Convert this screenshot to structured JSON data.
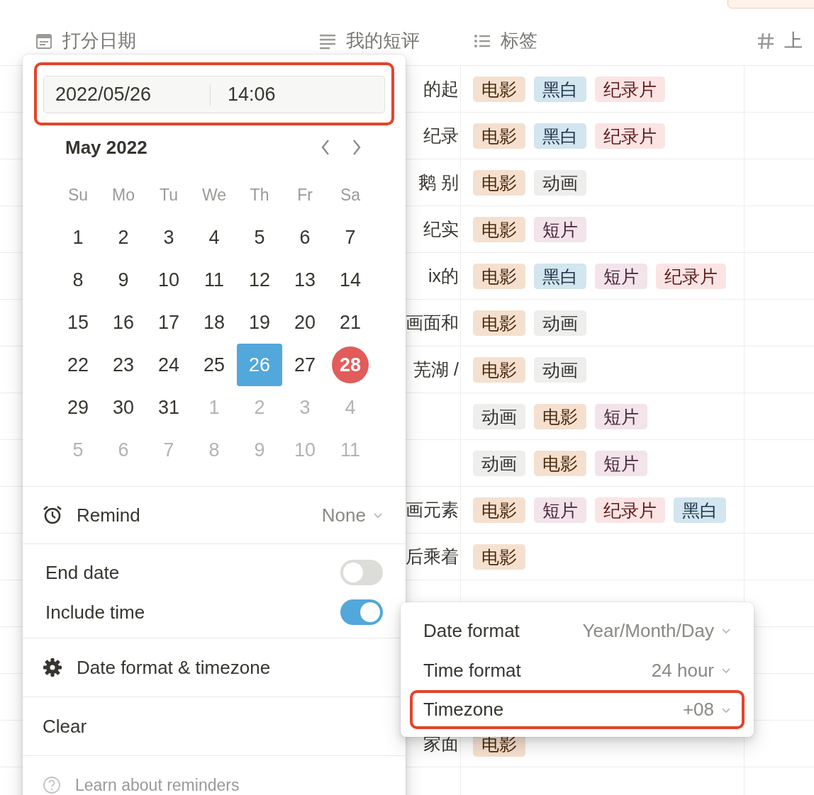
{
  "table": {
    "columns": [
      {
        "kind": "date",
        "label": "打分日期"
      },
      {
        "kind": "text",
        "label": "我的短评"
      },
      {
        "kind": "multi",
        "label": "标签"
      },
      {
        "kind": "number",
        "label": "上"
      }
    ],
    "rows": [
      {
        "review": "的起",
        "tags": [
          {
            "label": "电影",
            "color": "#f5e0cf"
          },
          {
            "label": "黑白",
            "color": "#d3e5ef"
          },
          {
            "label": "纪录片",
            "color": "#fbe4e4"
          }
        ]
      },
      {
        "review": "纪录",
        "tags": [
          {
            "label": "电影",
            "color": "#f5e0cf"
          },
          {
            "label": "黑白",
            "color": "#d3e5ef"
          },
          {
            "label": "纪录片",
            "color": "#fbe4e4"
          }
        ]
      },
      {
        "review": "鹅 别",
        "tags": [
          {
            "label": "电影",
            "color": "#f5e0cf"
          },
          {
            "label": "动画",
            "color": "#eeeeed"
          }
        ]
      },
      {
        "review": "纪实",
        "tags": [
          {
            "label": "电影",
            "color": "#f5e0cf"
          },
          {
            "label": "短片",
            "color": "#f2e4ea"
          }
        ]
      },
      {
        "review": "ix的",
        "tags": [
          {
            "label": "电影",
            "color": "#f5e0cf"
          },
          {
            "label": "黑白",
            "color": "#d3e5ef"
          },
          {
            "label": "短片",
            "color": "#f2e4ea"
          },
          {
            "label": "纪录片",
            "color": "#fbe4e4"
          }
        ]
      },
      {
        "review": "画面和",
        "tags": [
          {
            "label": "电影",
            "color": "#f5e0cf"
          },
          {
            "label": "动画",
            "color": "#eeeeed"
          }
        ]
      },
      {
        "review": "芜湖 /",
        "tags": [
          {
            "label": "电影",
            "color": "#f5e0cf"
          },
          {
            "label": "动画",
            "color": "#eeeeed"
          }
        ]
      },
      {
        "tags": [
          {
            "label": "动画",
            "color": "#eeeeed"
          },
          {
            "label": "电影",
            "color": "#f5e0cf"
          },
          {
            "label": "短片",
            "color": "#f2e4ea"
          }
        ]
      },
      {
        "tags": [
          {
            "label": "动画",
            "color": "#eeeeed"
          },
          {
            "label": "电影",
            "color": "#f5e0cf"
          },
          {
            "label": "短片",
            "color": "#f2e4ea"
          }
        ]
      },
      {
        "review": "画元素",
        "tags": [
          {
            "label": "电影",
            "color": "#f5e0cf"
          },
          {
            "label": "短片",
            "color": "#f2e4ea"
          },
          {
            "label": "纪录片",
            "color": "#fbe4e4"
          },
          {
            "label": "黑白",
            "color": "#d3e5ef"
          }
        ]
      },
      {
        "review": "后乘着",
        "tags": [
          {
            "label": "电影",
            "color": "#f5e0cf"
          }
        ]
      },
      {},
      {},
      {},
      {
        "review": "家面",
        "tags": [
          {
            "label": "电影",
            "color": "#f5e0cf"
          }
        ]
      },
      {}
    ]
  },
  "date_picker": {
    "date": "2022/05/26",
    "time": "14:06",
    "month": "May 2022",
    "weekdays": [
      "Su",
      "Mo",
      "Tu",
      "We",
      "Th",
      "Fr",
      "Sa"
    ],
    "weeks": [
      [
        {
          "day": "1",
          "outside": false,
          "selected": false,
          "today": false
        },
        {
          "day": "2",
          "outside": false,
          "selected": false,
          "today": false
        },
        {
          "day": "3",
          "outside": false,
          "selected": false,
          "today": false
        },
        {
          "day": "4",
          "outside": false,
          "selected": false,
          "today": false
        },
        {
          "day": "5",
          "outside": false,
          "selected": false,
          "today": false
        },
        {
          "day": "6",
          "outside": false,
          "selected": false,
          "today": false
        },
        {
          "day": "7",
          "outside": false,
          "selected": false,
          "today": false
        }
      ],
      [
        {
          "day": "8",
          "outside": false,
          "selected": false,
          "today": false
        },
        {
          "day": "9",
          "outside": false,
          "selected": false,
          "today": false
        },
        {
          "day": "10",
          "outside": false,
          "selected": false,
          "today": false
        },
        {
          "day": "11",
          "outside": false,
          "selected": false,
          "today": false
        },
        {
          "day": "12",
          "outside": false,
          "selected": false,
          "today": false
        },
        {
          "day": "13",
          "outside": false,
          "selected": false,
          "today": false
        },
        {
          "day": "14",
          "outside": false,
          "selected": false,
          "today": false
        }
      ],
      [
        {
          "day": "15",
          "outside": false,
          "selected": false,
          "today": false
        },
        {
          "day": "16",
          "outside": false,
          "selected": false,
          "today": false
        },
        {
          "day": "17",
          "outside": false,
          "selected": false,
          "today": false
        },
        {
          "day": "18",
          "outside": false,
          "selected": false,
          "today": false
        },
        {
          "day": "19",
          "outside": false,
          "selected": false,
          "today": false
        },
        {
          "day": "20",
          "outside": false,
          "selected": false,
          "today": false
        },
        {
          "day": "21",
          "outside": false,
          "selected": false,
          "today": false
        }
      ],
      [
        {
          "day": "22",
          "outside": false,
          "selected": false,
          "today": false
        },
        {
          "day": "23",
          "outside": false,
          "selected": false,
          "today": false
        },
        {
          "day": "24",
          "outside": false,
          "selected": false,
          "today": false
        },
        {
          "day": "25",
          "outside": false,
          "selected": false,
          "today": false
        },
        {
          "day": "26",
          "outside": false,
          "selected": true,
          "today": false
        },
        {
          "day": "27",
          "outside": false,
          "selected": false,
          "today": false
        },
        {
          "day": "28",
          "outside": false,
          "selected": false,
          "today": true
        }
      ],
      [
        {
          "day": "29",
          "outside": false,
          "selected": false,
          "today": false
        },
        {
          "day": "30",
          "outside": false,
          "selected": false,
          "today": false
        },
        {
          "day": "31",
          "outside": false,
          "selected": false,
          "today": false
        },
        {
          "day": "1",
          "outside": true,
          "selected": false,
          "today": false
        },
        {
          "day": "2",
          "outside": true,
          "selected": false,
          "today": false
        },
        {
          "day": "3",
          "outside": true,
          "selected": false,
          "today": false
        },
        {
          "day": "4",
          "outside": true,
          "selected": false,
          "today": false
        }
      ],
      [
        {
          "day": "5",
          "outside": true,
          "selected": false,
          "today": false
        },
        {
          "day": "6",
          "outside": true,
          "selected": false,
          "today": false
        },
        {
          "day": "7",
          "outside": true,
          "selected": false,
          "today": false
        },
        {
          "day": "8",
          "outside": true,
          "selected": false,
          "today": false
        },
        {
          "day": "9",
          "outside": true,
          "selected": false,
          "today": false
        },
        {
          "day": "10",
          "outside": true,
          "selected": false,
          "today": false
        },
        {
          "day": "11",
          "outside": true,
          "selected": false,
          "today": false
        }
      ]
    ],
    "remind": {
      "label": "Remind",
      "value": "None"
    },
    "toggles": [
      {
        "label": "End date",
        "on": false
      },
      {
        "label": "Include time",
        "on": true
      }
    ],
    "format_link": "Date format & timezone",
    "clear": "Clear",
    "help": "Learn about reminders"
  },
  "format_menu": {
    "rows": [
      {
        "label": "Date format",
        "value": "Year/Month/Day",
        "highlighted": false
      },
      {
        "label": "Time format",
        "value": "24 hour",
        "highlighted": false
      },
      {
        "label": "Timezone",
        "value": "+08",
        "highlighted": true
      }
    ]
  }
}
